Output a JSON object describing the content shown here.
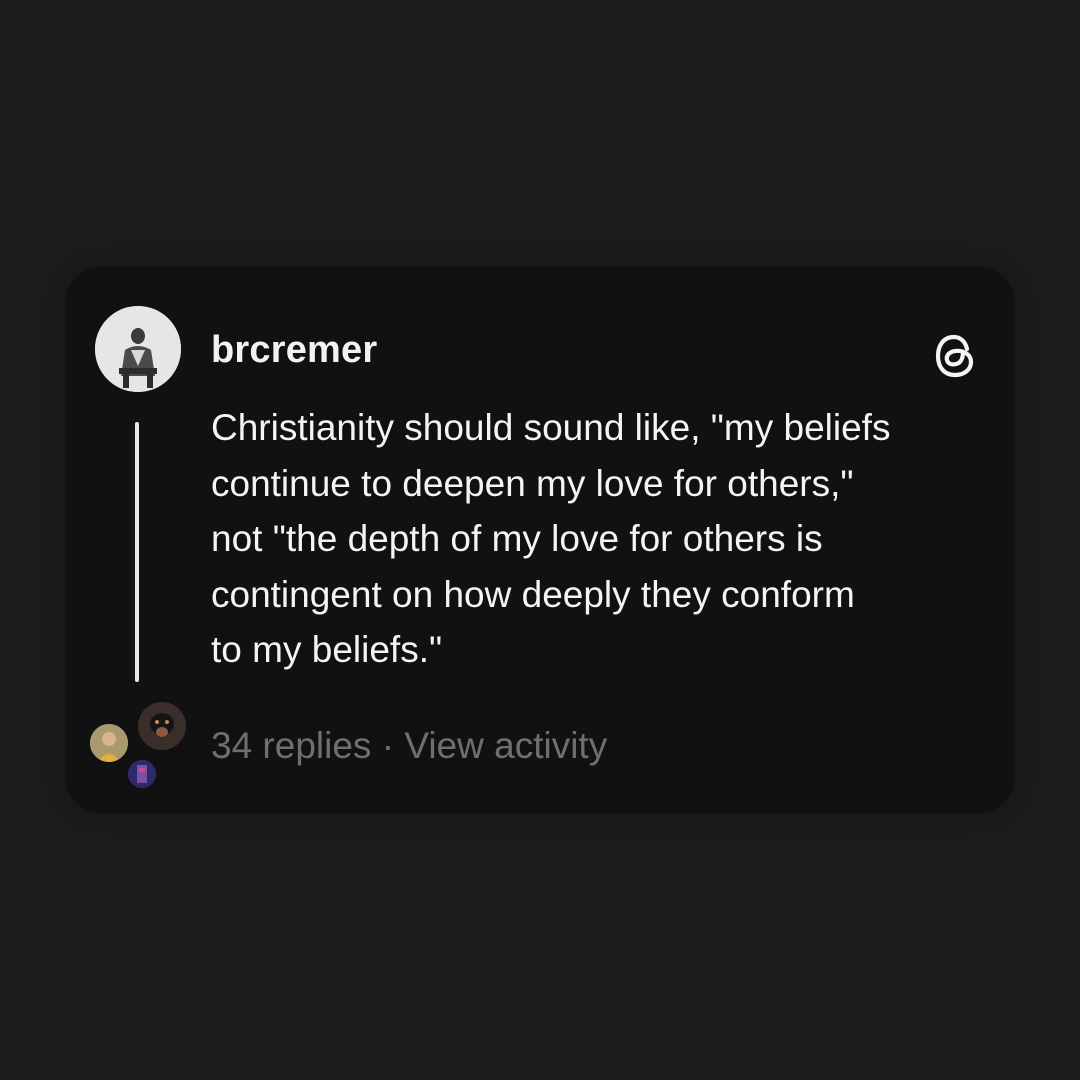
{
  "post": {
    "username": "brcremer",
    "text": "Christianity should sound like, \"my beliefs\ncontinue to deepen my love for others,\"\nnot \"the depth of my love for others is\ncontingent on how deeply they conform\nto my beliefs.\"",
    "reply_count": "34 replies",
    "separator": "·",
    "view_activity": "View activity"
  },
  "icons": {
    "brand": "threads-logo-icon",
    "avatar": "profile-photo"
  },
  "colors": {
    "page_background": "#1c1c1c",
    "card_background": "#111111",
    "text_primary": "#f4f4f4",
    "text_secondary": "#6f6f6f",
    "thread_line": "#e8e8e8"
  }
}
